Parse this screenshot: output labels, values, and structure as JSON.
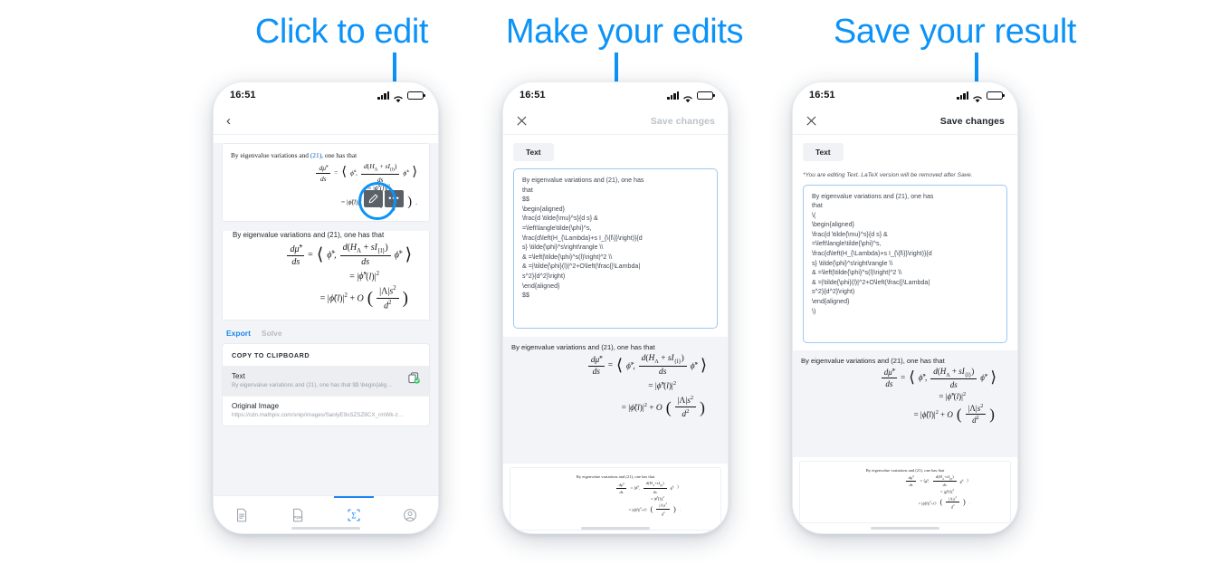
{
  "headlines": [
    {
      "text": "Click to edit"
    },
    {
      "text": "Make your edits"
    },
    {
      "text": "Save your result"
    }
  ],
  "accent_color": "#0d93f7",
  "phone1": {
    "status": {
      "clock": "16:51",
      "signal": "signal-bars",
      "wifi": "wifi",
      "battery": "battery-full"
    },
    "appbar": {
      "back": "‹"
    },
    "snippet": {
      "line1_prefix": "By eigenvalue variations and ",
      "line1_ref": "(21)",
      "line1_suffix": ", one has that"
    },
    "toolbar": {
      "edit_icon": "pencil-icon",
      "more_label": "•••"
    },
    "paragraph": "By eigenvalue variations and (21), one has that",
    "tabs": {
      "export": "Export",
      "solve": "Solve"
    },
    "panel": {
      "header": "COPY TO CLIPBOARD",
      "rows": [
        {
          "title": "Text",
          "subtitle": "By eigenvalue variations and (21), one has that $$ \\begin{alig…",
          "icon": "copy-success-icon",
          "selected": true
        },
        {
          "title": "Original Image",
          "subtitle": "https://cdn.mathpix.com/snip/images/SanlyE9sSZSZ8CX_rmWk-z…",
          "icon": "",
          "selected": false
        }
      ]
    },
    "tabbar": [
      {
        "name": "document",
        "label": "document-icon",
        "active": false
      },
      {
        "name": "pdf",
        "label": "pdf-icon",
        "active": false
      },
      {
        "name": "snip",
        "label": "sigma-snip-icon",
        "active": true
      },
      {
        "name": "account",
        "label": "account-icon",
        "active": false
      }
    ]
  },
  "phone2": {
    "status": {
      "clock": "16:51"
    },
    "appbar": {
      "close": "close-icon",
      "save": "Save changes",
      "save_enabled": false
    },
    "chip": "Text",
    "editor_lines": [
      "By eigenvalue variations and (21), one has",
      "that",
      "$$",
      "\\begin{aligned}",
      "\\frac{d \\tilde{\\mu}^s}{d s} &",
      "=\\left\\langle\\tilde{\\phi}^s,",
      "\\frac{d\\left(H_{\\Lambda}+s I_{\\{l\\}}\\right)}{d",
      "s} \\tilde{\\phi}^s\\right\\rangle \\\\",
      "& =\\left|\\tilde{\\phi}^s(l)\\right|^2 \\\\",
      "& =|\\tilde{\\phi}(l)|^2+O\\left(\\frac{|\\Lambda|",
      "s^2}{d^2}\\right)",
      "\\end{aligned}",
      "$$"
    ],
    "caption": "By eigenvalue variations and (21), one has that",
    "preview_caption": "By eigenvalue variations and (21), one has that"
  },
  "phone3": {
    "status": {
      "clock": "16:51"
    },
    "appbar": {
      "close": "close-icon",
      "save": "Save changes",
      "save_enabled": true
    },
    "chip": "Text",
    "note": "*You are editing Text. LaTeX version will be removed after Save.",
    "editor_lines": [
      "By eigenvalue variations and (21), one has",
      "that",
      "\\(",
      "\\begin{aligned}",
      "\\frac{d \\tilde{\\mu}^s}{d s} &",
      "=\\left\\langle\\tilde{\\phi}^s,",
      "\\frac{d\\left(H_{\\Lambda}+s I_{\\{l\\}}\\right)}{d",
      "s} \\tilde{\\phi}^s\\right\\rangle \\\\",
      "& =\\left|\\tilde{\\phi}^s(l)\\right|^2 \\\\",
      "& =|\\tilde{\\phi}(l)|^2+O\\left(\\frac{|\\Lambda|",
      "s^2}{d^2}\\right)",
      "\\end{aligned}",
      "\\)"
    ],
    "caption": "By eigenvalue variations and (21), one has that",
    "preview_caption": "By eigenvalue variations and (21), one has that"
  },
  "formula": {
    "lhs_num": "dμ̃ˢ",
    "lhs_den": "ds",
    "line2": "= |ϕ̃ˢ(l)|²",
    "line3": "= |ϕ̃(l)|² + O(|Λ|s²/d²)"
  }
}
